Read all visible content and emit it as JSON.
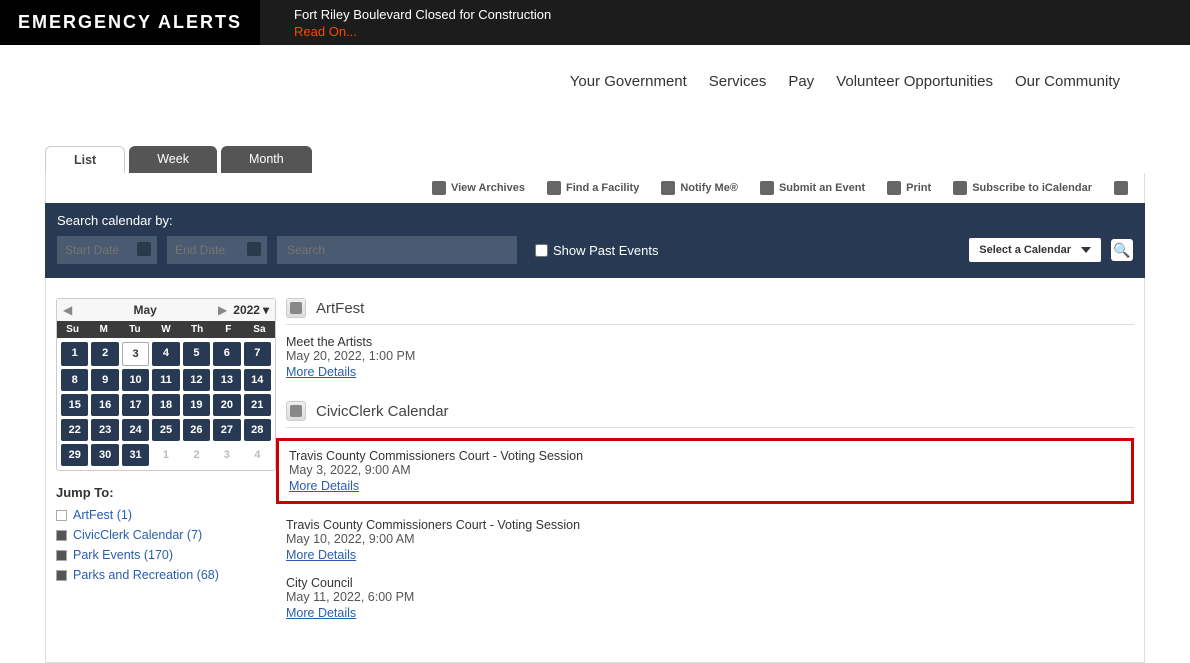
{
  "alert": {
    "title": "EMERGENCY ALERTS",
    "message": "Fort Riley Boulevard Closed for Construction",
    "read_on": "Read On..."
  },
  "nav": [
    "Your Government",
    "Services",
    "Pay",
    "Volunteer Opportunities",
    "Our Community"
  ],
  "tabs": {
    "list": "List",
    "week": "Week",
    "month": "Month"
  },
  "toolbar": {
    "view_archives": "View Archives",
    "find_facility": "Find a Facility",
    "notify_me": "Notify Me®",
    "submit_event": "Submit an Event",
    "print": "Print",
    "subscribe": "Subscribe to iCalendar"
  },
  "search": {
    "label": "Search calendar by:",
    "start": "Start Date",
    "end": "End Date",
    "placeholder": "Search",
    "show_past": "Show Past Events",
    "select_cal": "Select a Calendar"
  },
  "mini": {
    "month": "May",
    "year": "2022",
    "dow": [
      "Su",
      "M",
      "Tu",
      "W",
      "Th",
      "F",
      "Sa"
    ],
    "days": [
      {
        "n": "1",
        "t": "d"
      },
      {
        "n": "2",
        "t": "d"
      },
      {
        "n": "3",
        "t": "sel"
      },
      {
        "n": "4",
        "t": "d"
      },
      {
        "n": "5",
        "t": "d"
      },
      {
        "n": "6",
        "t": "d"
      },
      {
        "n": "7",
        "t": "d"
      },
      {
        "n": "8",
        "t": "d"
      },
      {
        "n": "9",
        "t": "d"
      },
      {
        "n": "10",
        "t": "d"
      },
      {
        "n": "11",
        "t": "d"
      },
      {
        "n": "12",
        "t": "d"
      },
      {
        "n": "13",
        "t": "d"
      },
      {
        "n": "14",
        "t": "d"
      },
      {
        "n": "15",
        "t": "d"
      },
      {
        "n": "16",
        "t": "d"
      },
      {
        "n": "17",
        "t": "d"
      },
      {
        "n": "18",
        "t": "d"
      },
      {
        "n": "19",
        "t": "d"
      },
      {
        "n": "20",
        "t": "d"
      },
      {
        "n": "21",
        "t": "d"
      },
      {
        "n": "22",
        "t": "d"
      },
      {
        "n": "23",
        "t": "d"
      },
      {
        "n": "24",
        "t": "d"
      },
      {
        "n": "25",
        "t": "d"
      },
      {
        "n": "26",
        "t": "d"
      },
      {
        "n": "27",
        "t": "d"
      },
      {
        "n": "28",
        "t": "d"
      },
      {
        "n": "29",
        "t": "d"
      },
      {
        "n": "30",
        "t": "d"
      },
      {
        "n": "31",
        "t": "d"
      },
      {
        "n": "1",
        "t": "o"
      },
      {
        "n": "2",
        "t": "o"
      },
      {
        "n": "3",
        "t": "o"
      },
      {
        "n": "4",
        "t": "o"
      }
    ]
  },
  "jump": {
    "title": "Jump To:",
    "items": [
      {
        "label": "ArtFest (1)",
        "filled": false
      },
      {
        "label": "CivicClerk Calendar (7)",
        "filled": true
      },
      {
        "label": "Park Events (170)",
        "filled": true
      },
      {
        "label": "Parks and Recreation (68)",
        "filled": true
      }
    ]
  },
  "categories": [
    {
      "name": "ArtFest",
      "events": [
        {
          "title": "Meet the Artists",
          "datetime": "May 20, 2022, 1:00 PM",
          "more": "More Details",
          "hl": false
        }
      ]
    },
    {
      "name": "CivicClerk Calendar",
      "events": [
        {
          "title": "Travis County Commissioners Court - Voting Session",
          "datetime": "May 3, 2022, 9:00 AM",
          "more": "More Details",
          "hl": true
        },
        {
          "title": "Travis County Commissioners Court - Voting Session",
          "datetime": "May 10, 2022, 9:00 AM",
          "more": "More Details",
          "hl": false
        },
        {
          "title": "City Council",
          "datetime": "May 11, 2022, 6:00 PM",
          "more": "More Details",
          "hl": false
        }
      ]
    }
  ]
}
